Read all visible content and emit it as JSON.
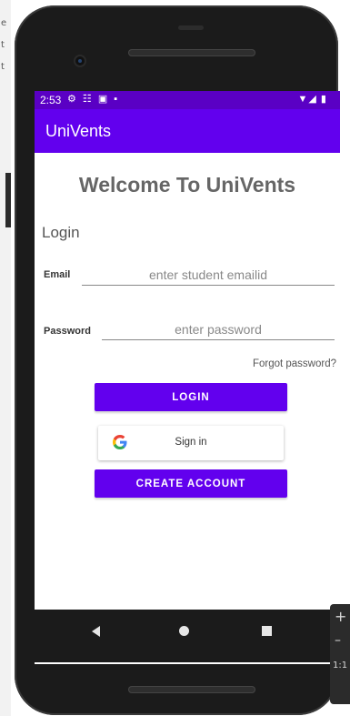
{
  "desktop": {
    "left_letters": [
      "e",
      "t",
      "t"
    ]
  },
  "status_bar": {
    "time": "2:53",
    "left_icons": "⚙ ☷ ▣ ▪",
    "right_icons": "▼◢ ▮"
  },
  "app_bar": {
    "title": "UniVents"
  },
  "main": {
    "welcome": "Welcome To UniVents",
    "login_heading": "Login",
    "email": {
      "label": "Email",
      "placeholder": "enter student emailid"
    },
    "password": {
      "label": "Password",
      "placeholder": "enter password"
    },
    "forgot": "Forgot password?",
    "login_button": "LOGIN",
    "google_button": {
      "icon": "google-g-icon",
      "label": "Sign in"
    },
    "create_button": "CREATE ACCOUNT"
  },
  "emulator_toolbar": {
    "plus": "+",
    "minus": "–",
    "ratio": "1:1"
  },
  "colors": {
    "primary": "#6200EE",
    "status_bar": "#5A00C4"
  }
}
